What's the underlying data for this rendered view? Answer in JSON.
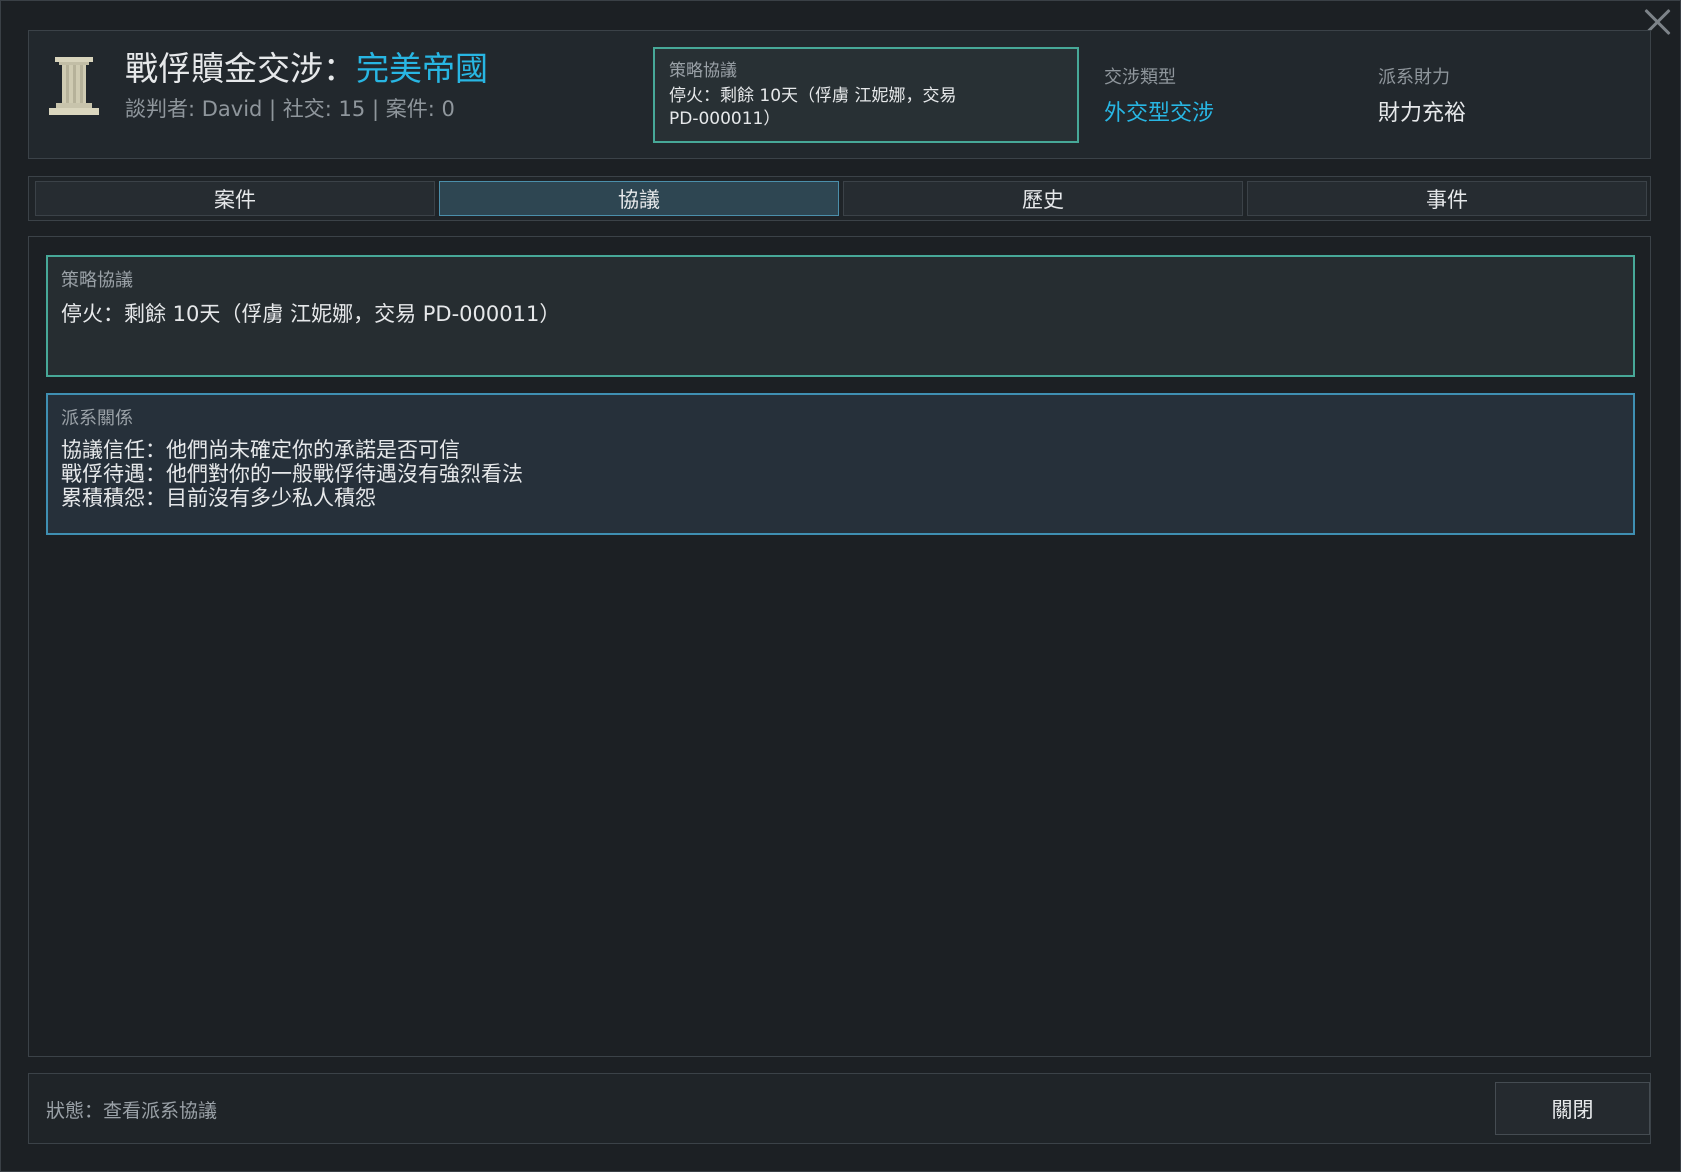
{
  "header": {
    "title_prefix": "戰俘贖金交涉：",
    "title_accent": "完美帝國",
    "meta": "談判者: David | 社交: 15  |  案件: 0",
    "strategy_box": {
      "label": "策略協議",
      "text": "停火：剩餘 10天（俘虜 江妮娜，交易 PD-000011）"
    },
    "negotiation_type": {
      "label": "交涉類型",
      "value": "外交型交涉"
    },
    "faction_wealth": {
      "label": "派系財力",
      "value": "財力充裕"
    }
  },
  "tabs": [
    {
      "label": "案件"
    },
    {
      "label": "協議"
    },
    {
      "label": "歷史"
    },
    {
      "label": "事件"
    }
  ],
  "active_tab": "協議",
  "content": {
    "strategy_card": {
      "label": "策略協議",
      "text": "停火：剩餘 10天（俘虜 江妮娜，交易 PD-000011）"
    },
    "relation_card": {
      "label": "派系關係",
      "lines": [
        "協議信任：他們尚未確定你的承諾是否可信",
        "戰俘待遇：他們對你的一般戰俘待遇沒有強烈看法",
        "累積積怨：目前沒有多少私人積怨"
      ]
    }
  },
  "status": {
    "text": "狀態：查看派系協議",
    "close_label": "關閉"
  },
  "colors": {
    "accent_blue": "#28b6e3",
    "strategy_border": "#47a898",
    "relation_border": "#3f8fb2",
    "background": "#1c2024"
  },
  "icons": {
    "emblem": "pillar-icon",
    "close": "close-icon"
  }
}
